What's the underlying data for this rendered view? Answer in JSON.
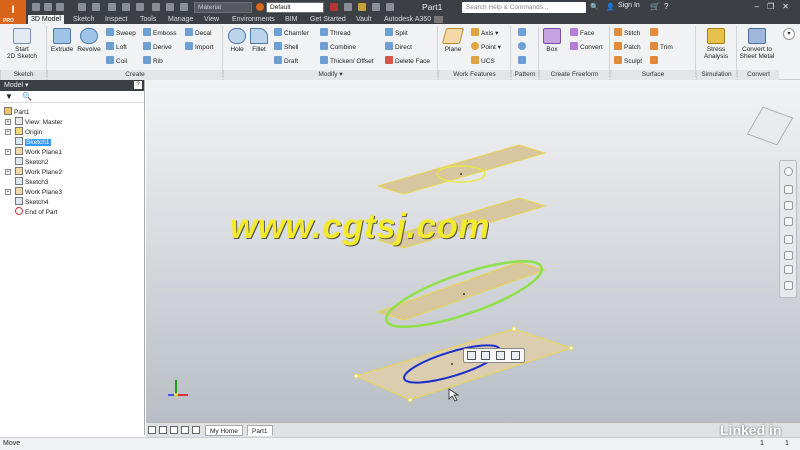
{
  "app": {
    "badge": "I",
    "badge_sub": "PRO",
    "document_title": "Part1"
  },
  "quick_access": {
    "material": "Material",
    "appearance": "Default"
  },
  "search": {
    "placeholder": "Search Help & Commands..."
  },
  "account": {
    "sign_in": "Sign In"
  },
  "tabs": [
    "3D Model",
    "Sketch",
    "Inspect",
    "Tools",
    "Manage",
    "View",
    "Environments",
    "BIM",
    "Get Started",
    "Vault",
    "Autodesk A360"
  ],
  "ribbon": {
    "sketch_panel": {
      "start_sketch": "Start",
      "start_sketch2": "2D Sketch",
      "label": "Sketch"
    },
    "create_panel": {
      "extrude": "Extrude",
      "revolve": "Revolve",
      "sweep": "Sweep",
      "loft": "Loft",
      "coil": "Coil",
      "emboss": "Emboss",
      "derive": "Derive",
      "rib": "Rib",
      "decal": "Decal",
      "import": "Import",
      "label": "Create"
    },
    "modify_panel": {
      "hole": "Hole",
      "fillet": "Fillet",
      "chamfer": "Chamfer",
      "shell": "Shell",
      "draft": "Draft",
      "thread": "Thread",
      "combine": "Combine",
      "thicken": "Thicken/ Offset",
      "split": "Split",
      "direct": "Direct",
      "delete_face": "Delete Face",
      "label": "Modify ▾"
    },
    "work_features": {
      "plane": "Plane",
      "axis": "Axis ▾",
      "point": "Point ▾",
      "ucs": "UCS",
      "label": "Work Features"
    },
    "pattern": {
      "label": "Pattern"
    },
    "freeform": {
      "box": "Box",
      "face": "Face",
      "convert": "Convert",
      "label": "Create Freeform"
    },
    "surface": {
      "stitch": "Stitch",
      "patch": "Patch",
      "sculpt": "Sculpt",
      "trim": "Trim",
      "label": "Surface"
    },
    "simulation": {
      "stress1": "Stress",
      "stress2": "Analysis",
      "label": "Simulation"
    },
    "convert": {
      "sheet1": "Convert to",
      "sheet2": "Sheet Metal",
      "label": "Convert"
    }
  },
  "browser": {
    "title": "Model ▾",
    "help": "?",
    "items": [
      "Part1",
      "View: Master",
      "Origin",
      "Sketch1",
      "Work Plane1",
      "Sketch2",
      "Work Plane2",
      "Sketch3",
      "Work Plane3",
      "Sketch4",
      "End of Part"
    ]
  },
  "doc_tabs": {
    "home": "My Home",
    "part": "Part1"
  },
  "status": {
    "text": "Move",
    "page1": "1",
    "page2": "1"
  },
  "overlay": {
    "watermark": "www.cgtsj.com",
    "brand": "Linked in"
  },
  "colors": {
    "accent_orange": "#d9651b",
    "sketch_plane": "#d7c6a0",
    "sketch_outline": "#e8d64a",
    "ellipse_green": "#8fe04a",
    "ellipse_blue": "#1a2fc9",
    "selection": "#3399ff"
  }
}
